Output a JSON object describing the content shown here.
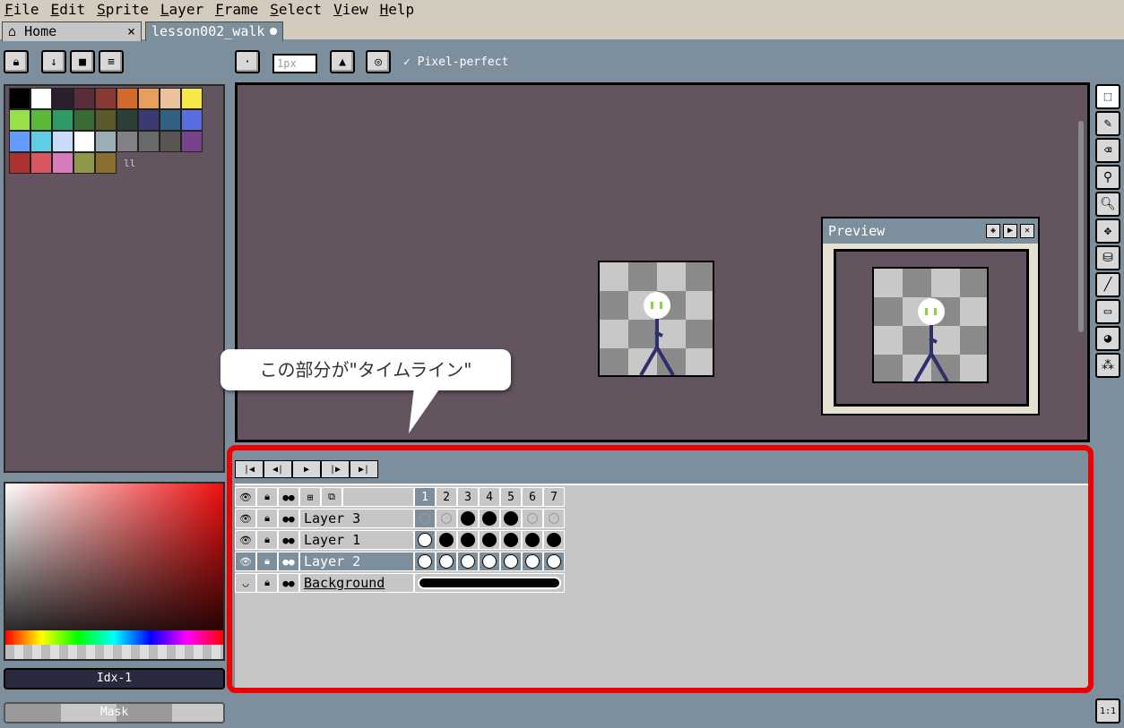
{
  "menu": [
    {
      "u": "F",
      "rest": "ile"
    },
    {
      "u": "E",
      "rest": "dit"
    },
    {
      "u": "S",
      "rest": "prite"
    },
    {
      "u": "L",
      "rest": "ayer"
    },
    {
      "u": "F",
      "rest": "rame"
    },
    {
      "u": "S",
      "rest": "elect"
    },
    {
      "u": "V",
      "rest": "iew"
    },
    {
      "u": "H",
      "rest": "elp"
    }
  ],
  "tabs": {
    "home": "Home",
    "home_close": "×",
    "doc": "lesson002_walk"
  },
  "toolbar": {
    "brush_size": "1px",
    "pixel_perfect": "Pixel-perfect"
  },
  "palette": [
    "#000000",
    "#ffffff",
    "#2b1e2e",
    "#5a2d3b",
    "#8a3a34",
    "#d16a2a",
    "#e6a05c",
    "#eac39a",
    "#f7e84a",
    "#97e04a",
    "#5bb83a",
    "#2f9a64",
    "#3a6b36",
    "#5b5a2c",
    "#2e3f35",
    "#3b3b73",
    "#306082",
    "#5b6ee1",
    "#639bff",
    "#5fcde4",
    "#cbdbfc",
    "#ffffff",
    "#9badb7",
    "#847e87",
    "#696a6a",
    "#595652",
    "#76428a",
    "#ac3232",
    "#d95763",
    "#d77bba",
    "#8f974a",
    "#8a6f30"
  ],
  "color_index": "Idx-1",
  "mask_label": "Mask",
  "callout": "この部分が\"タイムライン\"",
  "preview": {
    "title": "Preview"
  },
  "timeline": {
    "frames": [
      "1",
      "2",
      "3",
      "4",
      "5",
      "6",
      "7"
    ],
    "layers": [
      {
        "name": "Layer 3",
        "cels": [
          "empty-sel",
          "empty",
          "full",
          "full",
          "full",
          "empty",
          "empty"
        ]
      },
      {
        "name": "Layer 1",
        "cels": [
          "white",
          "full",
          "full",
          "full",
          "full",
          "full",
          "full"
        ]
      },
      {
        "name": "Layer 2",
        "cels": [
          "white",
          "white",
          "white",
          "white",
          "white",
          "white",
          "white"
        ]
      },
      {
        "name": "Background",
        "cels": [
          "linked"
        ]
      }
    ]
  },
  "zoom_button": "1:1"
}
